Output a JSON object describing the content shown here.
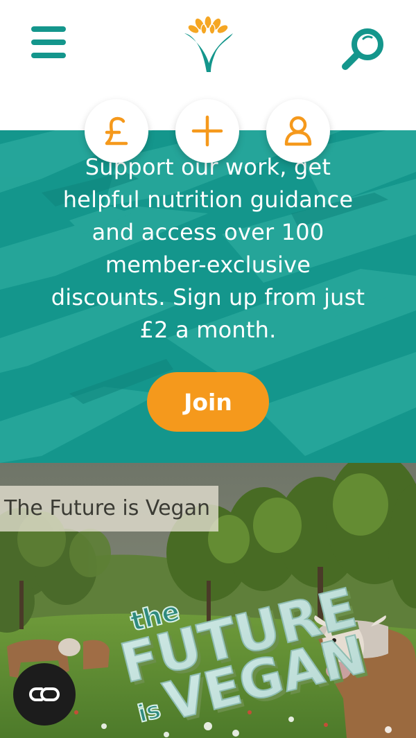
{
  "header": {
    "menu_icon": "hamburger-menu-icon",
    "logo_icon": "vegan-society-sunflower-logo",
    "search_icon": "search-icon"
  },
  "quick_actions": [
    {
      "icon": "pound-sign-icon"
    },
    {
      "icon": "plus-icon"
    },
    {
      "icon": "user-icon"
    }
  ],
  "hero": {
    "lines": [
      "Support our work, get",
      "helpful nutrition guidance",
      "and access over 100",
      "member-exclusive",
      "discounts. Sign up from just",
      "£2 a month."
    ],
    "join_label": "Join"
  },
  "video": {
    "title": "The Future is Vegan",
    "overlay_the": "the",
    "overlay_future": "FUTURE",
    "overlay_is": "is",
    "overlay_vegan": "VEGAN",
    "cc_icon": "closed-captions-icon"
  },
  "colors": {
    "teal": "#14968c",
    "orange": "#f5991c",
    "white": "#ffffff"
  }
}
